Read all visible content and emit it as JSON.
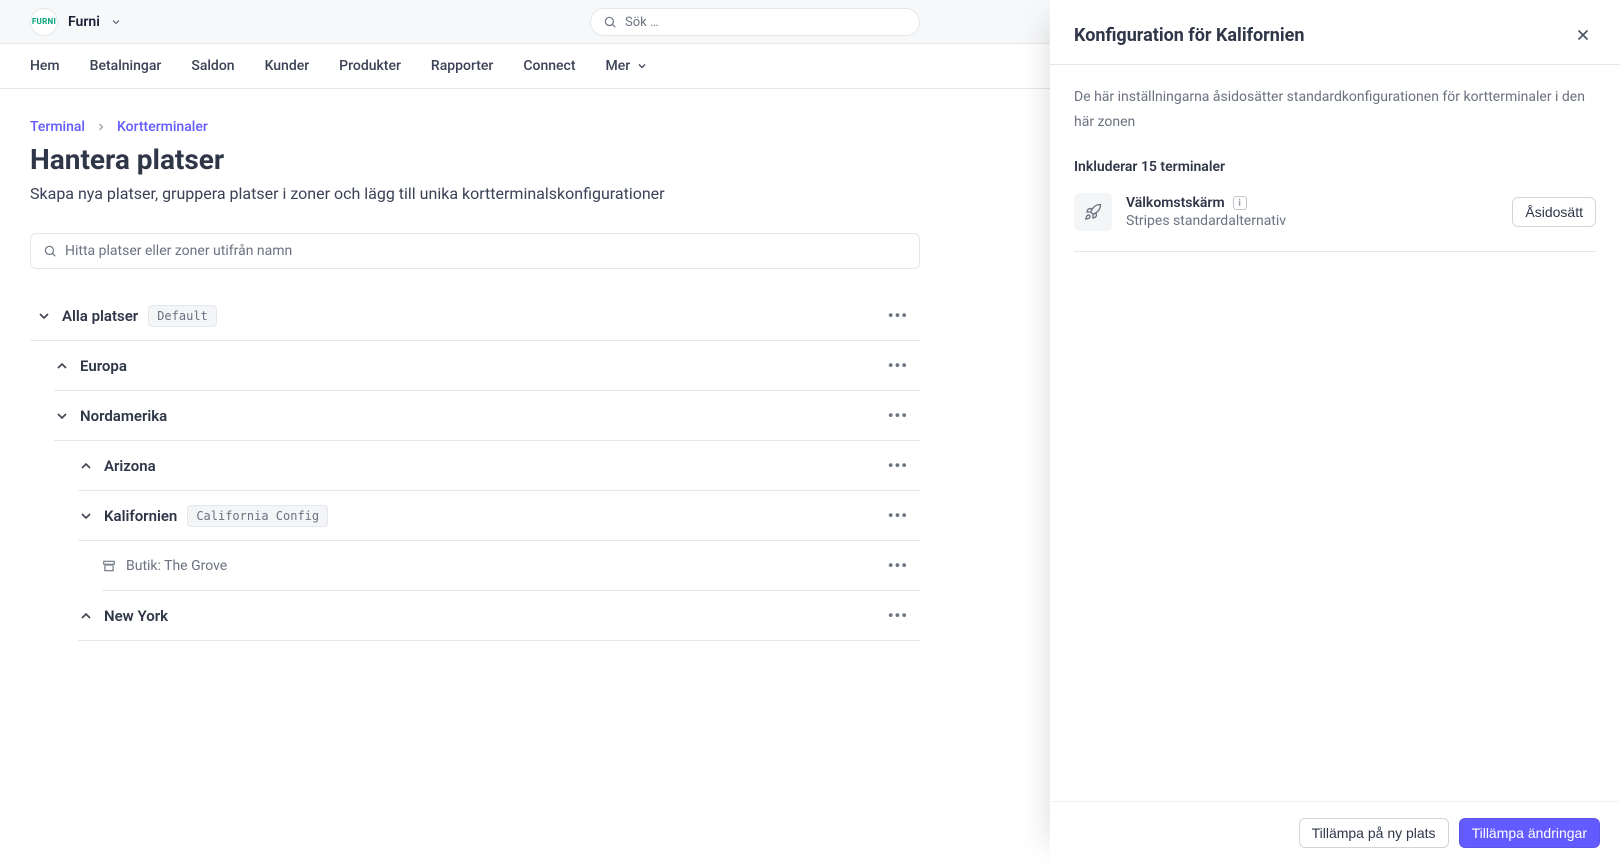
{
  "brand": {
    "logo_text": "FURNI",
    "name": "Furni"
  },
  "search": {
    "placeholder": "Sök …"
  },
  "nav": {
    "home": "Hem",
    "payments": "Betalningar",
    "balances": "Saldon",
    "customers": "Kunder",
    "products": "Produkter",
    "reports": "Rapporter",
    "connect": "Connect",
    "more": "Mer"
  },
  "breadcrumb": {
    "terminal": "Terminal",
    "readers": "Kortterminaler"
  },
  "page": {
    "title": "Hantera platser",
    "subtitle": "Skapa nya platser, gruppera platser i zoner och lägg till unika kortterminalskonfigurationer"
  },
  "filter": {
    "placeholder": "Hitta platser eller zoner utifrån namn"
  },
  "tree": {
    "all_locations": {
      "label": "Alla platser",
      "badge": "Default"
    },
    "europe": {
      "label": "Europa"
    },
    "north_america": {
      "label": "Nordamerika"
    },
    "arizona": {
      "label": "Arizona"
    },
    "california": {
      "label": "Kalifornien",
      "badge": "California Config"
    },
    "grove": {
      "label": "Butik: The Grove"
    },
    "newyork": {
      "label": "New York"
    }
  },
  "panel": {
    "title": "Konfiguration för Kalifornien",
    "description": "De här inställningarna åsidosätter standardkonfigurationen för kortterminaler i den här zonen",
    "includes": "Inkluderar 15 terminaler",
    "setting": {
      "title": "Välkomstskärm",
      "subtitle": "Stripes standardalternativ",
      "override_btn": "Åsidosätt"
    },
    "footer": {
      "apply_new": "Tillämpa på ny plats",
      "apply_changes": "Tillämpa ändringar"
    }
  }
}
